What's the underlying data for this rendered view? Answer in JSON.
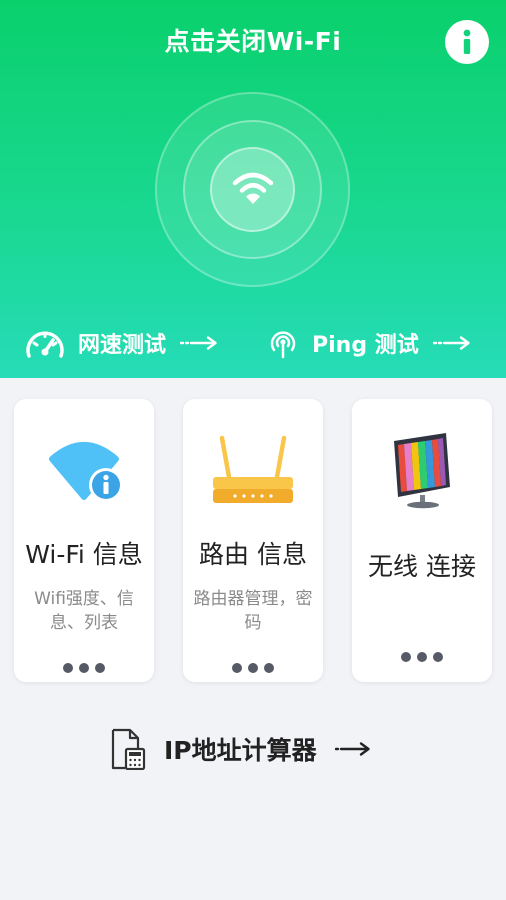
{
  "header": {
    "title": "点击关闭Wi-Fi",
    "info_icon": "info-icon"
  },
  "colors": {
    "hero_top": "#0ad06c",
    "hero_bottom": "#26dcb8",
    "wifi_blue": "#4fc1f7",
    "router_yellow": "#f9c64a"
  },
  "quick_actions": {
    "speed": {
      "label": "网速测试",
      "icon": "speedometer-icon"
    },
    "ping": {
      "label": "Ping 测试",
      "icon": "ping-signal-icon"
    }
  },
  "cards": [
    {
      "title": "Wi-Fi 信息",
      "desc": "Wifi强度、信息、列表",
      "icon": "wifi-info-icon"
    },
    {
      "title": "路由 信息",
      "desc": "路由器管理，密码",
      "icon": "router-icon"
    },
    {
      "title": "无线 连接",
      "desc": "",
      "icon": "monitor-icon"
    }
  ],
  "ip_calculator": {
    "label": "IP地址计算器",
    "icon": "calculator-document-icon"
  }
}
